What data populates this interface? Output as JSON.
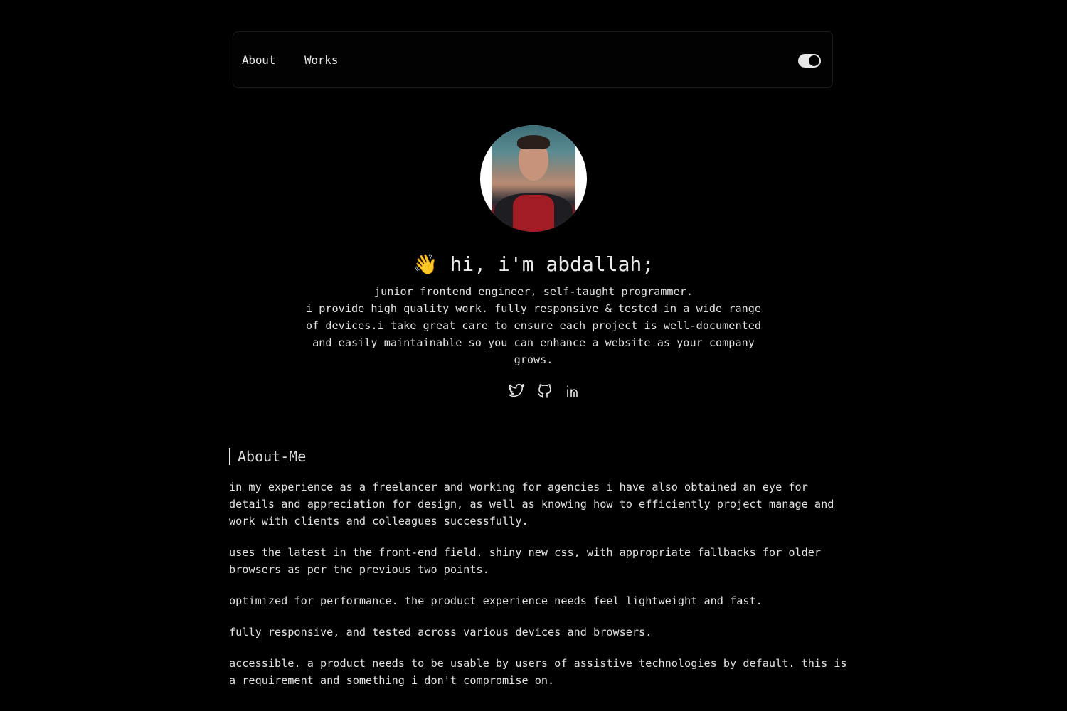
{
  "nav": {
    "links": [
      {
        "label": "About"
      },
      {
        "label": "Works"
      }
    ],
    "theme_toggle": {
      "state": "on"
    }
  },
  "hero": {
    "title": "👋 hi, i'm abdallah;",
    "subtitle_line1": "junior frontend engineer, self-taught programmer.",
    "subtitle_line2": "i provide high quality work. fully responsive & tested in a wide range of devices.i take great care to ensure each project is well-documented and easily maintainable so you can enhance a website as your company grows.",
    "socials": [
      {
        "icon": "twitter-icon"
      },
      {
        "icon": "github-icon"
      },
      {
        "icon": "linkedin-icon"
      }
    ]
  },
  "about": {
    "heading": "About-Me",
    "paragraphs": [
      "in my experience as a freelancer and working for agencies i have also obtained an eye for details and appreciation for design, as well as knowing how to efficiently project manage and work with clients and colleagues successfully.",
      "uses the latest in the front-end field. shiny new css, with appropriate fallbacks for older browsers as per the previous two points.",
      "optimized for performance. the product experience needs feel lightweight and fast.",
      "fully responsive, and tested across various devices and browsers.",
      "accessible. a product needs to be usable by users of assistive technologies by default. this is a requirement and something i don't compromise on."
    ]
  },
  "colors": {
    "background": "#000000",
    "text": "#e6e6e6"
  }
}
